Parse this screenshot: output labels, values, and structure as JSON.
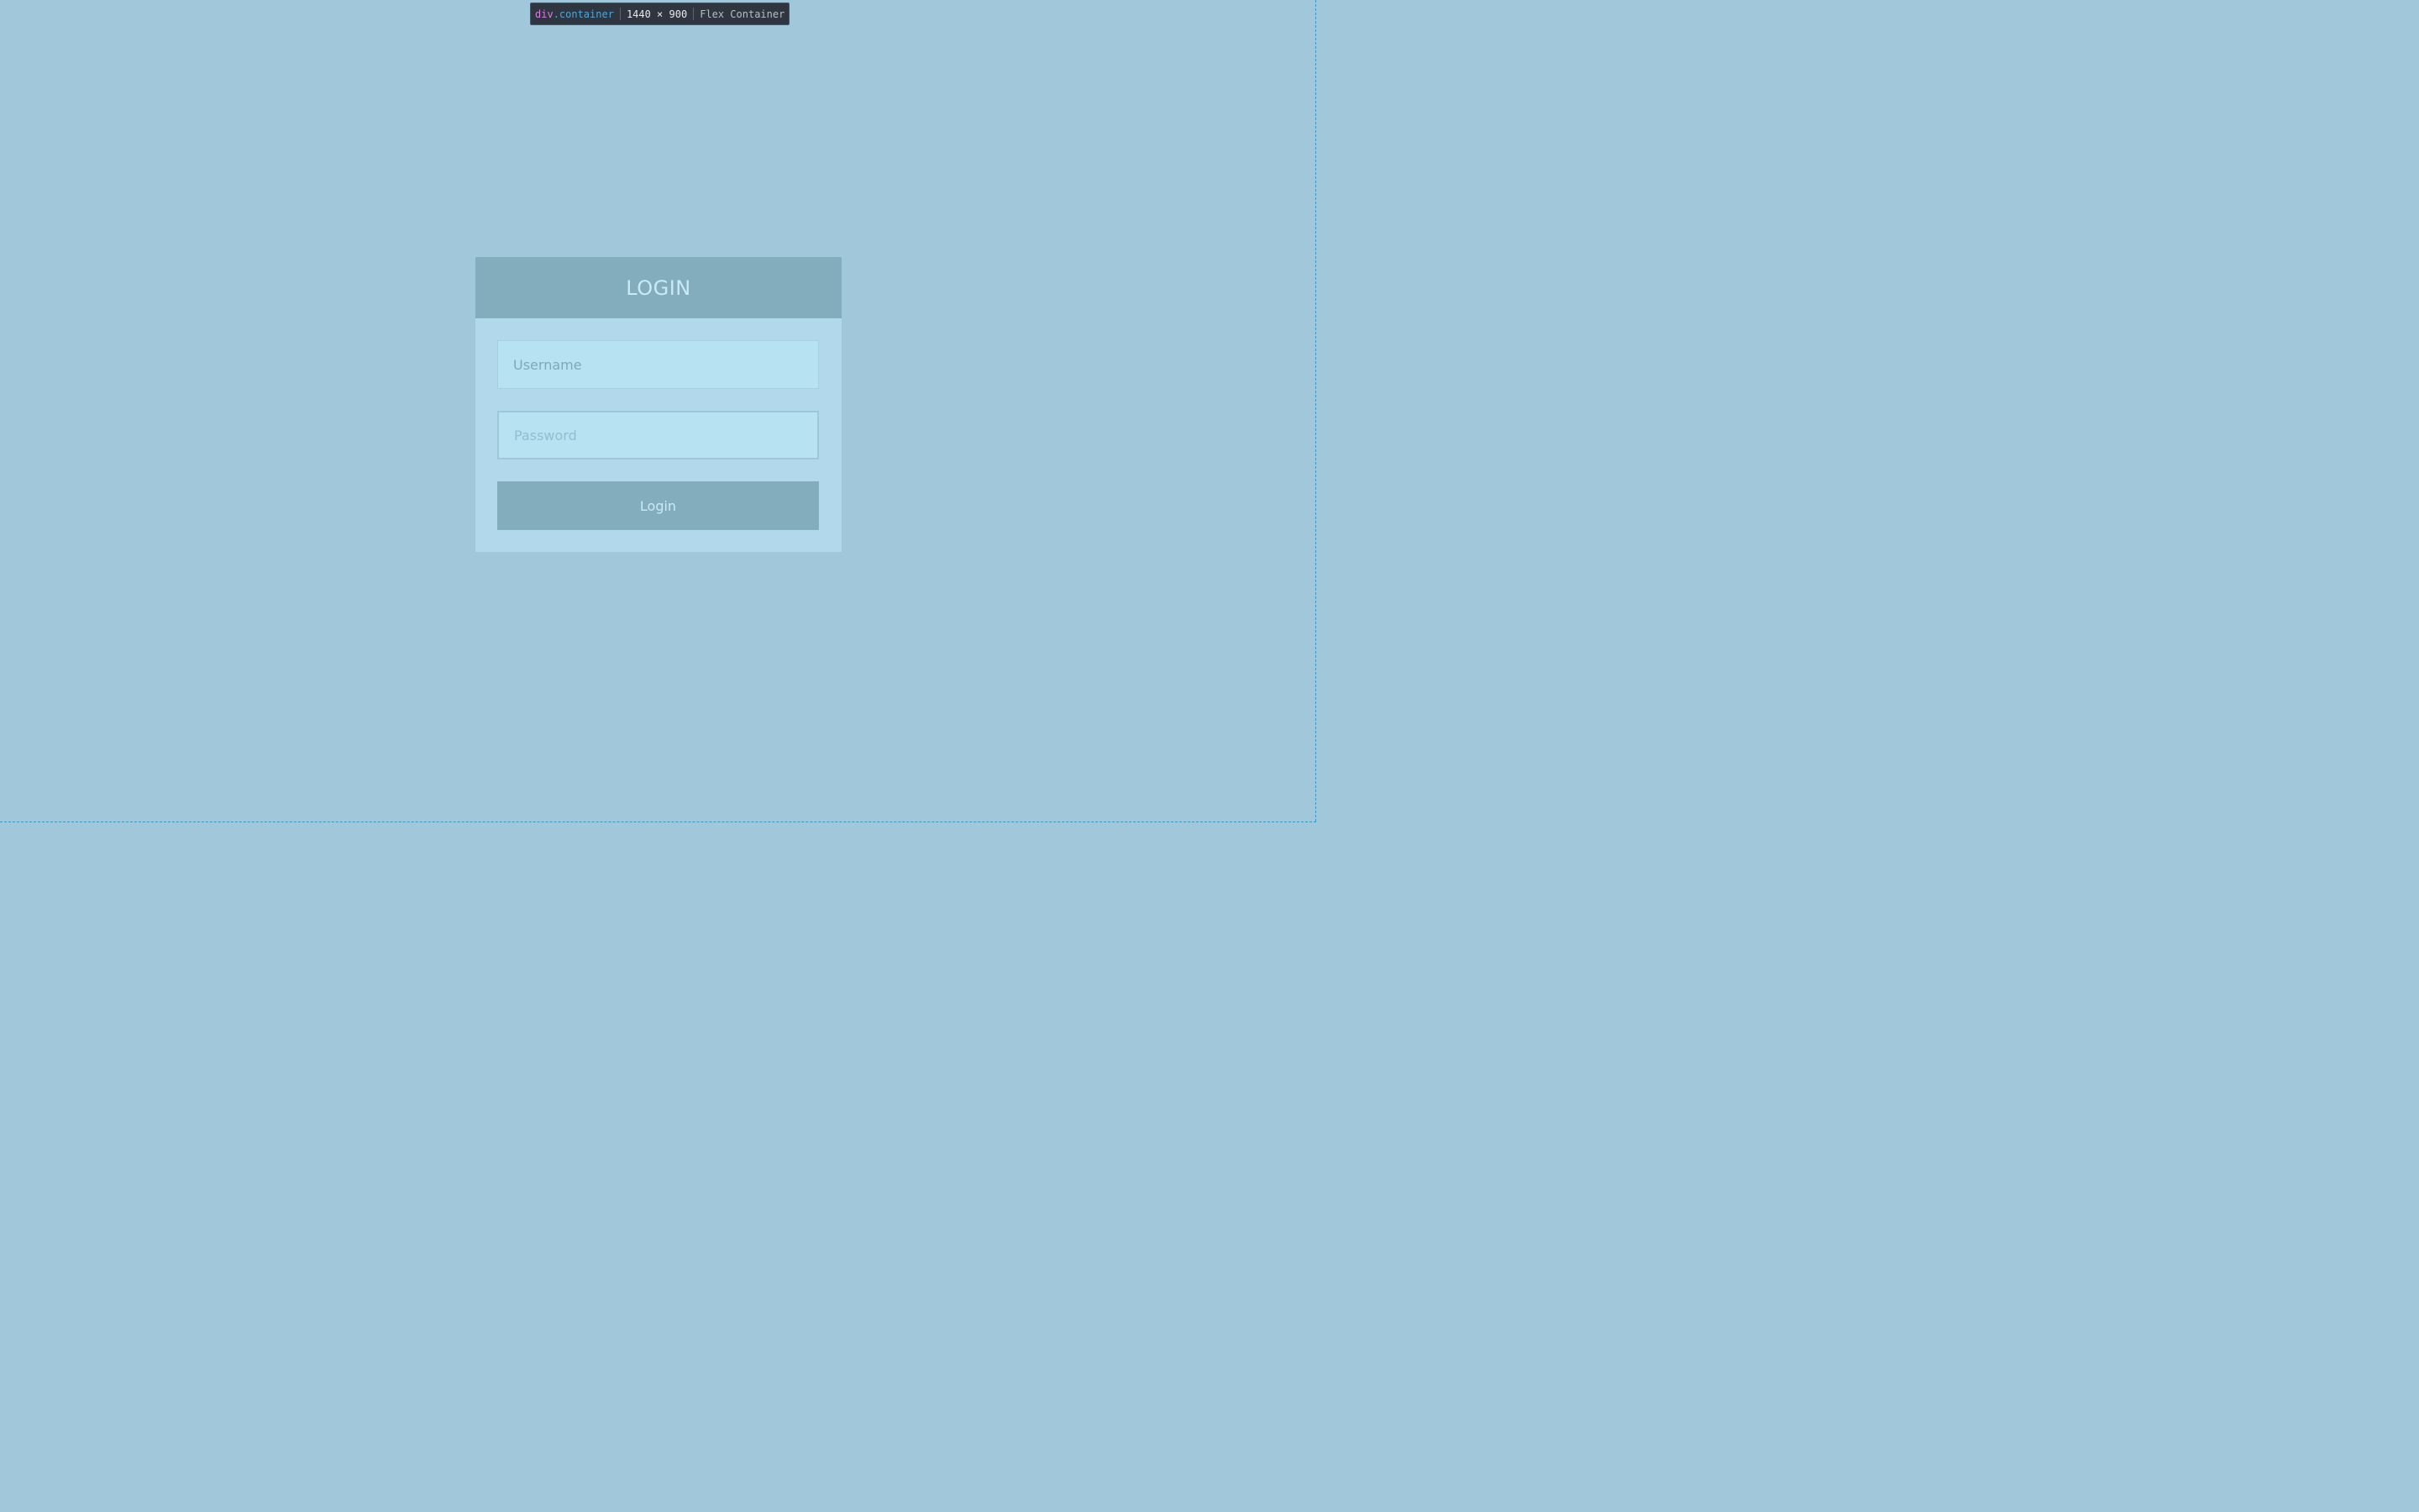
{
  "devtools_tooltip": {
    "tag": "div",
    "class_name": ".container",
    "dimensions": "1440 × 900",
    "container_type": "Flex Container"
  },
  "login": {
    "title": "LOGIN",
    "username_placeholder": "Username",
    "password_placeholder": "Password",
    "button_label": "Login"
  },
  "colors": {
    "background": "#a0c8da",
    "card": "#b1d9eb",
    "header": "#83adbd",
    "input": "#b6e2f2",
    "text_light": "#c8eaf7",
    "highlight_outline": "#3a95c2"
  }
}
